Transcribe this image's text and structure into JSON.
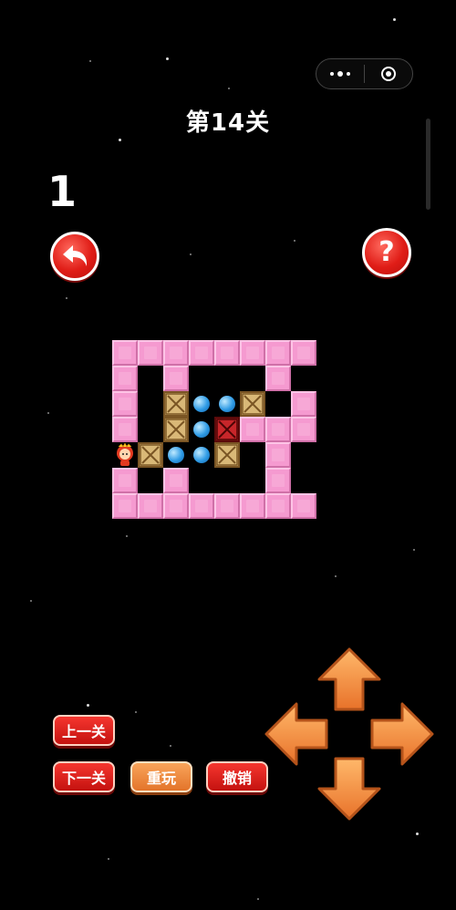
{
  "status": {
    "menu_icon": "more-dots-icon",
    "close_icon": "target-circle-icon"
  },
  "level": {
    "title": "第14关"
  },
  "moves": {
    "count": "1"
  },
  "controls": {
    "undo_round_icon": "undo-arrow-icon",
    "help_icon": "question-mark-icon",
    "prev_level_label": "上一关",
    "next_level_label": "下一关",
    "replay_label": "重玩",
    "undo_label": "撤销"
  },
  "dpad": {
    "up": "arrow-up-icon",
    "down": "arrow-down-icon",
    "left": "arrow-left-icon",
    "right": "arrow-right-icon"
  },
  "board": {
    "cols": 8,
    "rows": 7,
    "legend": {
      "#": "wall",
      ".": "goal",
      "$": "box",
      "*": "box-on-goal",
      "@": "player",
      " ": "floor",
      "-": "outside"
    },
    "map": [
      "########",
      "# #   #",
      "# $..$ #",
      "# $.*###",
      "@$..$ #",
      "# #   #",
      "########"
    ]
  },
  "colors": {
    "wall": "#f59ad0",
    "goal": "#2f9be5",
    "box": "#d9b877",
    "box_on_goal": "#c7262a",
    "button_red": "#e01d17",
    "button_orange": "#f28a3c",
    "arrow": "#f2933a"
  }
}
